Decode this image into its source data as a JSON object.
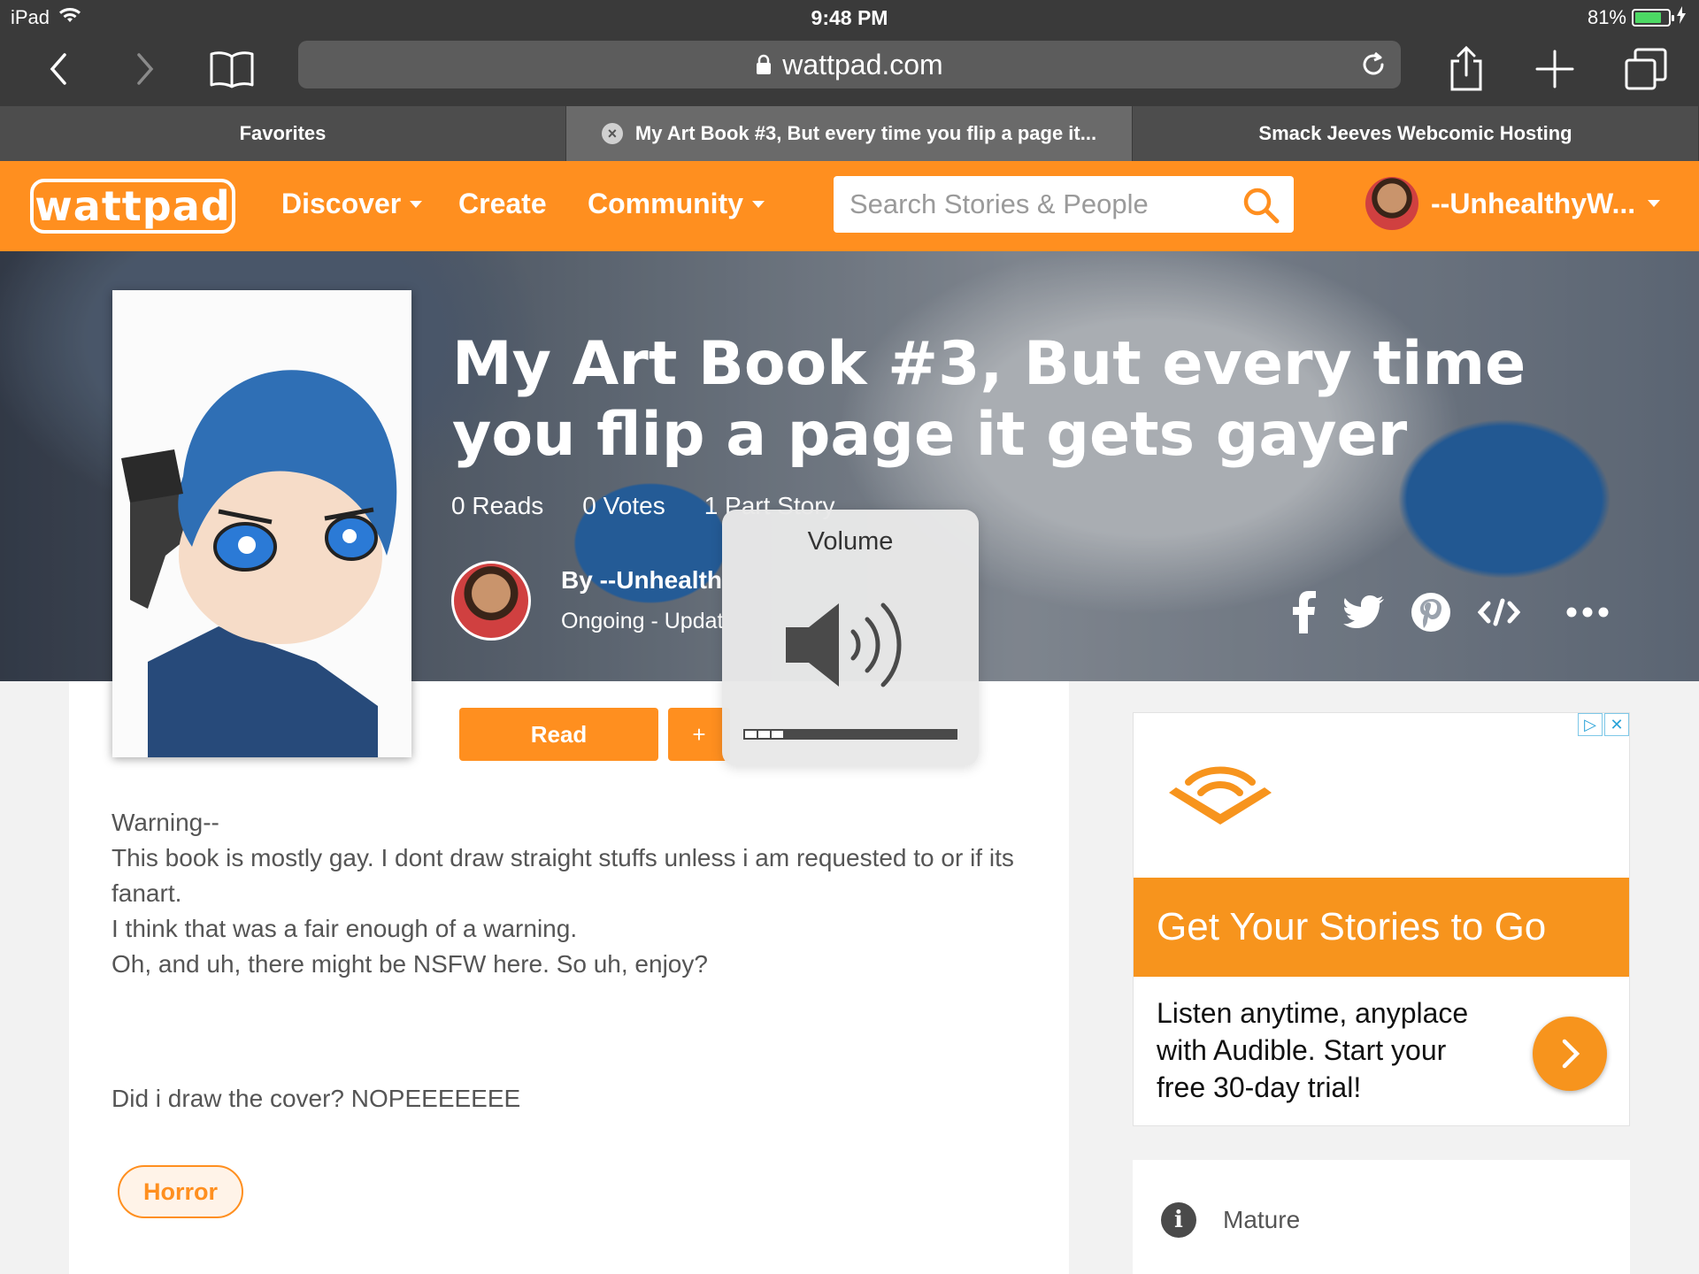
{
  "status_bar": {
    "device": "iPad",
    "time": "9:48 PM",
    "battery": "81%"
  },
  "browser": {
    "url": "wattpad.com",
    "tabs": [
      {
        "label": "Favorites"
      },
      {
        "label": "My Art Book #3, But every time you flip a page it..."
      },
      {
        "label": "Smack Jeeves Webcomic Hosting"
      }
    ]
  },
  "header": {
    "logo": "wattpad",
    "nav": {
      "discover": "Discover",
      "create": "Create",
      "community": "Community"
    },
    "search_placeholder": "Search Stories & People",
    "username": "--UnhealthyW..."
  },
  "story": {
    "title": "My Art Book #3, But every time you flip a page it gets gayer",
    "stats": {
      "reads": "0 Reads",
      "votes": "0 Votes",
      "parts": "1 Part Story"
    },
    "author_by": "By --Unhealth",
    "status": "Ongoing - Updat",
    "read_label": "Read",
    "add_label": "+",
    "description_lines": [
      "Warning--",
      "This book is mostly gay. I dont draw straight stuffs unless i am requested to or if its fanart.",
      "I think that was a fair enough of a warning.",
      "Oh, and uh, there might be NSFW here. So uh, enjoy?"
    ],
    "description_extra": "Did i draw the cover? NOPEEEEEEE",
    "tag": "Horror"
  },
  "ad": {
    "headline": "Get Your Stories to Go",
    "body": "Listen anytime, anyplace with Audible. Start your free 30-day trial!"
  },
  "info": {
    "rating": "Mature"
  },
  "volume_hud": {
    "label": "Volume",
    "level": 0.2
  },
  "colors": {
    "wattpad_orange": "#ff8f1f",
    "audible_orange": "#f7941d"
  }
}
